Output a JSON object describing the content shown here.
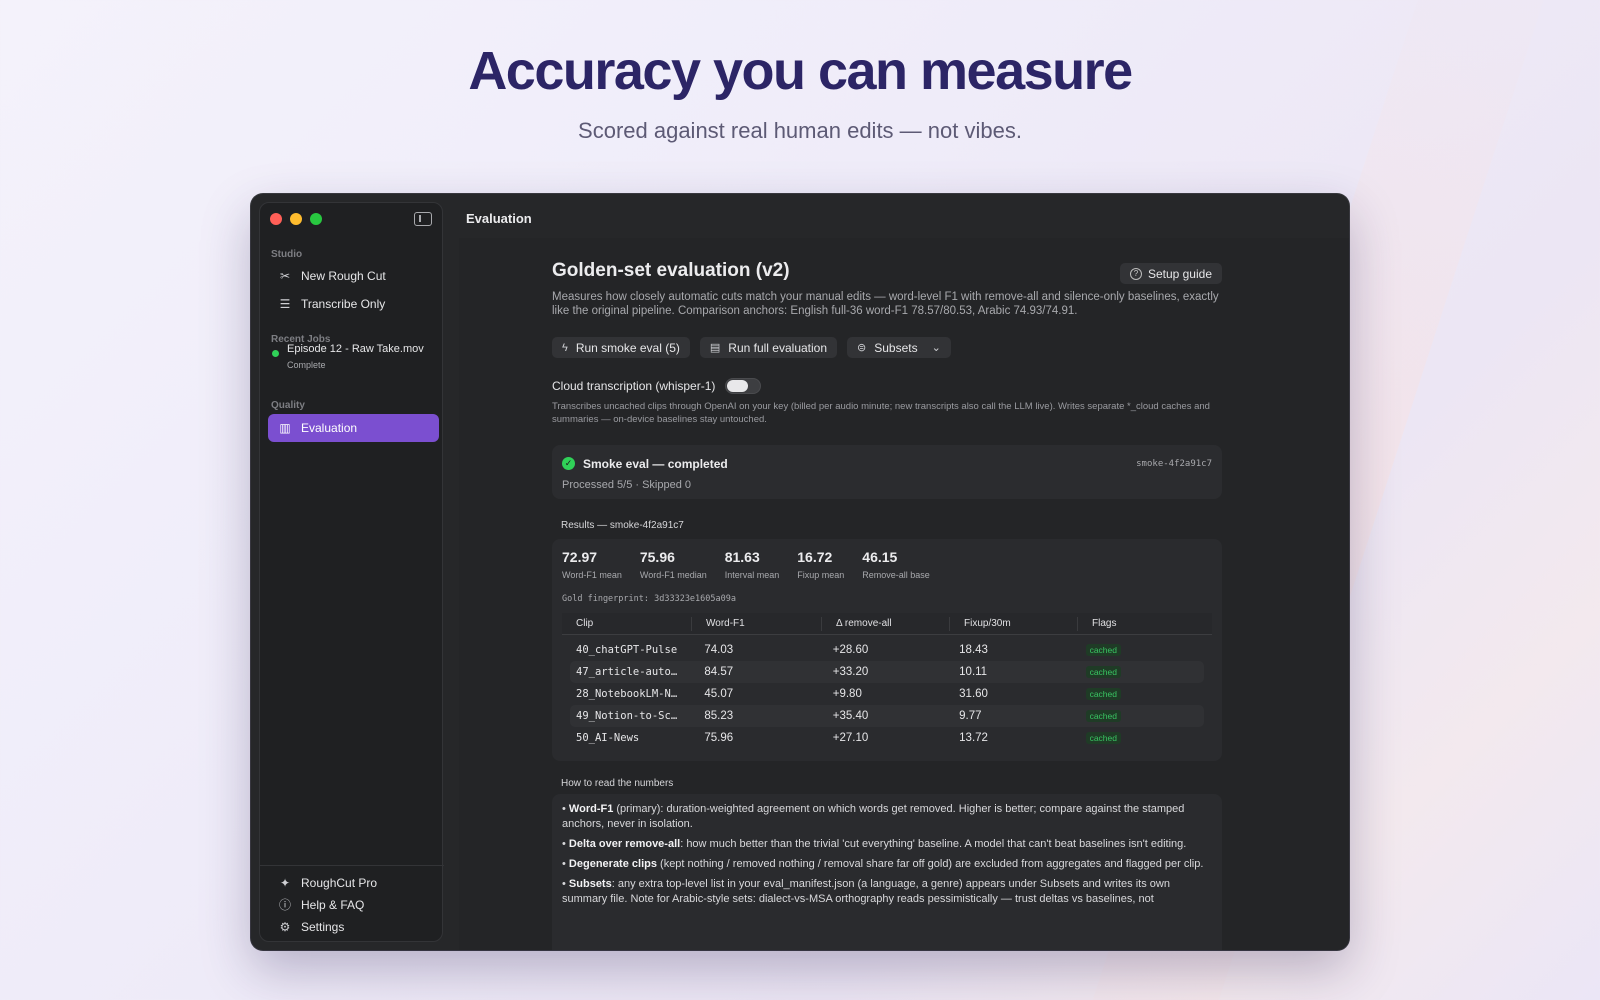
{
  "hero": {
    "title": "Accuracy you can measure",
    "subtitle": "Scored against real human edits — not vibes."
  },
  "sidebar": {
    "sections": {
      "studio": "Studio",
      "recent": "Recent Jobs",
      "quality": "Quality"
    },
    "items": [
      {
        "label": "New Rough Cut",
        "icon": "scissors-icon"
      },
      {
        "label": "Transcribe Only",
        "icon": "list-icon"
      },
      {
        "label": "Evaluation",
        "icon": "chart-icon"
      }
    ],
    "recent_job": {
      "name": "Episode 12 - Raw Take.mov",
      "status": "Complete"
    },
    "bottom": [
      {
        "label": "RoughCut Pro",
        "icon": "sparkle-icon"
      },
      {
        "label": "Help & FAQ",
        "icon": "help-icon"
      },
      {
        "label": "Settings",
        "icon": "gear-icon"
      }
    ]
  },
  "main": {
    "window_title": "Evaluation",
    "eval_title": "Golden-set evaluation (v2)",
    "setup_guide": "Setup guide",
    "description": "Measures how closely automatic cuts match your manual edits — word-level F1 with remove-all and silence-only baselines, exactly like the original pipeline. Comparison anchors: English full-36 word-F1 78.57/80.53, Arabic 74.93/74.91.",
    "actions": {
      "smoke": "Run smoke eval (5)",
      "full": "Run full evaluation",
      "subsets": "Subsets"
    },
    "cloud": {
      "label": "Cloud transcription (whisper-1)",
      "enabled": false,
      "note": "Transcribes uncached clips through OpenAI on your key (billed per audio minute; new transcripts also call the LLM live). Writes separate *_cloud caches and summaries — on-device baselines stay untouched."
    },
    "status": {
      "title": "Smoke eval — completed",
      "sub": "Processed 5/5 · Skipped 0",
      "id": "smoke-4f2a91c7"
    },
    "results_label": "Results — smoke-4f2a91c7",
    "stats": [
      {
        "value": "72.97",
        "label": "Word-F1 mean"
      },
      {
        "value": "75.96",
        "label": "Word-F1 median"
      },
      {
        "value": "81.63",
        "label": "Interval mean"
      },
      {
        "value": "16.72",
        "label": "Fixup mean"
      },
      {
        "value": "46.15",
        "label": "Remove-all base"
      }
    ],
    "fingerprint": "Gold fingerprint: 3d33323e1605a09a",
    "table": {
      "headers": [
        "Clip",
        "Word-F1",
        "Δ remove-all",
        "Fixup/30m",
        "Flags"
      ],
      "rows": [
        [
          "40_chatGPT-Pulse",
          "74.03",
          "+28.60",
          "18.43",
          "cached"
        ],
        [
          "47_article-auto…",
          "84.57",
          "+33.20",
          "10.11",
          "cached"
        ],
        [
          "28_NotebookLM-N…",
          "45.07",
          "+9.80",
          "31.60",
          "cached"
        ],
        [
          "49_Notion-to-Sc…",
          "85.23",
          "+35.40",
          "9.77",
          "cached"
        ],
        [
          "50_AI-News",
          "75.96",
          "+27.10",
          "13.72",
          "cached"
        ]
      ]
    },
    "howto_label": "How to read the numbers",
    "howto": [
      {
        "term": "Word-F1",
        "text": " (primary): duration-weighted agreement on which words get removed. Higher is better; compare against the stamped anchors, never in isolation."
      },
      {
        "term": "Delta over remove-all",
        "text": ": how much better than the trivial 'cut everything' baseline. A model that can't beat baselines isn't editing."
      },
      {
        "term": "Degenerate clips",
        "text": " (kept nothing / removed nothing / removal share far off gold) are excluded from aggregates and flagged per clip."
      },
      {
        "term": "Subsets",
        "text": ": any extra top-level list in your eval_manifest.json (a language, a genre) appears under Subsets and writes its own summary file. Note for Arabic-style sets: dialect-vs-MSA orthography reads pessimistically — trust deltas vs baselines, not"
      }
    ]
  }
}
